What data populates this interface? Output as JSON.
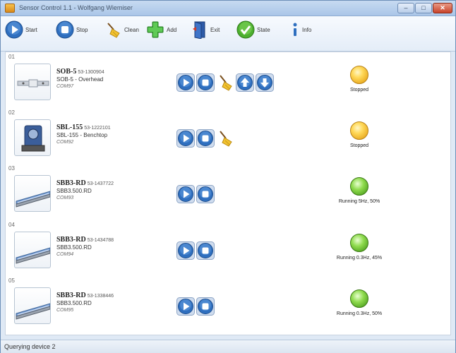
{
  "window": {
    "title": "Sensor Control 1.1 - Wolfgang Wiemiser",
    "minimize_label": "–",
    "maximize_label": "□",
    "close_label": "✕"
  },
  "toolbar": {
    "start_label": "Start",
    "stop_label": "Stop",
    "clean_label": "Clean",
    "add_label": "Add",
    "exit_label": "Exit",
    "state_label": "State",
    "info_label": "Info"
  },
  "devices": [
    {
      "index": "01",
      "name": "SOB-5",
      "serial": "53-1300904",
      "model": "SOB-5 - Overhead",
      "port": "COM97",
      "controls": [
        "start",
        "stop",
        "clean",
        "up",
        "down"
      ],
      "lamp": "yellow",
      "state": "Stopped"
    },
    {
      "index": "02",
      "name": "SBL-155",
      "serial": "53-1222101",
      "model": "SBL-155 - Benchtop",
      "port": "COM92",
      "controls": [
        "start",
        "stop",
        "clean"
      ],
      "lamp": "yellow",
      "state": "Stopped"
    },
    {
      "index": "03",
      "name": "SBB3-RD",
      "serial": "53-1437722",
      "model": "SBB3.500.RD",
      "port": "COM93",
      "controls": [
        "start",
        "stop"
      ],
      "lamp": "green",
      "state": "Running 5Hz, 50%"
    },
    {
      "index": "04",
      "name": "SBB3-RD",
      "serial": "53-1434788",
      "model": "SBB3.500.RD",
      "port": "COM94",
      "controls": [
        "start",
        "stop"
      ],
      "lamp": "green",
      "state": "Running 0.3Hz, 45%"
    },
    {
      "index": "05",
      "name": "SBB3-RD",
      "serial": "53-1338446",
      "model": "SBB3.500.RD",
      "port": "COM95",
      "controls": [
        "start",
        "stop"
      ],
      "lamp": "green",
      "state": "Running 0.3Hz, 50%"
    }
  ],
  "statusbar": {
    "text": "Querying device 2"
  },
  "colors": {
    "accent_blue": "#2f6fbf",
    "lamp_yellow": "#ffd95a",
    "lamp_green": "#7cc83f"
  }
}
